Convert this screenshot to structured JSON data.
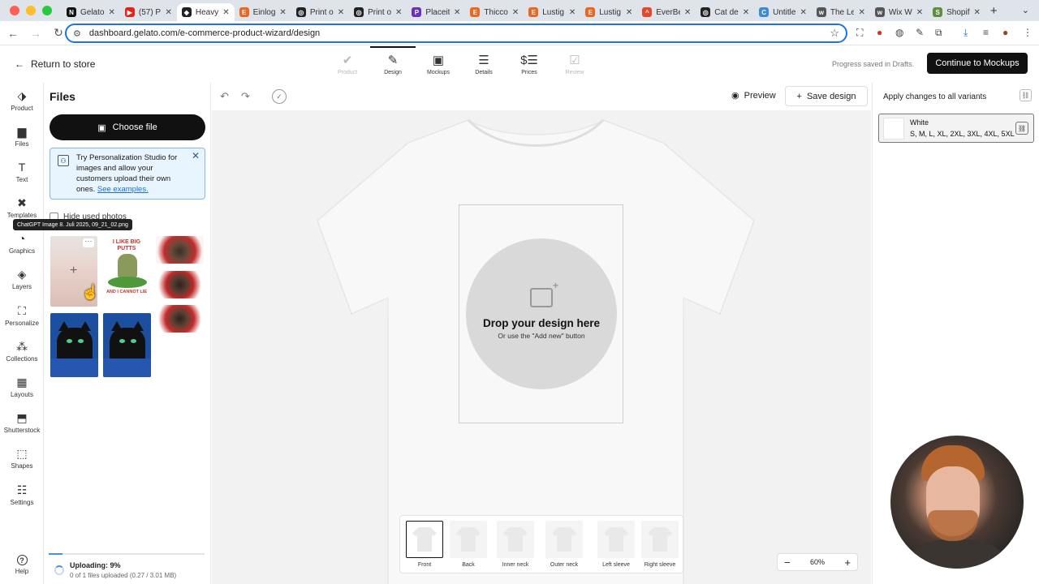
{
  "browser": {
    "tabs": [
      {
        "label": "Gelato",
        "icon": "notion-icon",
        "fav_color": "#111111",
        "fav_text": "N"
      },
      {
        "label": "(57) P",
        "icon": "youtube-icon",
        "fav_color": "#e62117",
        "fav_text": "▶"
      },
      {
        "label": "Heavy",
        "icon": "gelato-icon",
        "fav_color": "#222222",
        "fav_text": "◆",
        "active": true
      },
      {
        "label": "Einlog",
        "icon": "etsy-icon",
        "fav_color": "#f1641e",
        "fav_text": "E"
      },
      {
        "label": "Print o",
        "icon": "chatgpt-icon",
        "fav_color": "#222222",
        "fav_text": "◎"
      },
      {
        "label": "Print o",
        "icon": "chatgpt-icon",
        "fav_color": "#222222",
        "fav_text": "◎"
      },
      {
        "label": "Placeit",
        "icon": "placeit-icon",
        "fav_color": "#6b2fbf",
        "fav_text": "P"
      },
      {
        "label": "Thicco",
        "icon": "etsy-icon",
        "fav_color": "#f1641e",
        "fav_text": "E"
      },
      {
        "label": "Lustig",
        "icon": "etsy-icon",
        "fav_color": "#f1641e",
        "fav_text": "E"
      },
      {
        "label": "Lustig",
        "icon": "etsy-icon",
        "fav_color": "#f1641e",
        "fav_text": "E"
      },
      {
        "label": "EverBe",
        "icon": "everbee-icon",
        "fav_color": "#e8462a",
        "fav_text": "^"
      },
      {
        "label": "Cat de",
        "icon": "chatgpt-icon",
        "fav_color": "#222222",
        "fav_text": "◎"
      },
      {
        "label": "Untitle",
        "icon": "canva-icon",
        "fav_color": "#3b8bd9",
        "fav_text": "C"
      },
      {
        "label": "The Le",
        "icon": "wix-icon",
        "fav_color": "#555555",
        "fav_text": "w"
      },
      {
        "label": "Wix W",
        "icon": "wix-icon",
        "fav_color": "#555555",
        "fav_text": "w"
      },
      {
        "label": "Shopif",
        "icon": "shopify-icon",
        "fav_color": "#5e8e3e",
        "fav_text": "S"
      }
    ],
    "url": "dashboard.gelato.com/e-commerce-product-wizard/design"
  },
  "header": {
    "back_label": "Return to store",
    "steps": [
      {
        "label": "Product",
        "icon": "check-circle-icon",
        "glyph": "✔",
        "state": "done"
      },
      {
        "label": "Design",
        "icon": "pencil-icon",
        "glyph": "✎",
        "state": "active"
      },
      {
        "label": "Mockups",
        "icon": "image-icon",
        "glyph": "▣",
        "state": "normal"
      },
      {
        "label": "Details",
        "icon": "list-icon",
        "glyph": "☰",
        "state": "normal"
      },
      {
        "label": "Prices",
        "icon": "dollar-icon",
        "glyph": "$☰",
        "state": "normal"
      },
      {
        "label": "Review",
        "icon": "checklist-icon",
        "glyph": "☑",
        "state": "disabled"
      }
    ],
    "progress_text": "Progress saved in Drafts.",
    "continue_label": "Continue to Mockups"
  },
  "rail": [
    {
      "label": "Product",
      "icon": "tag-icon",
      "glyph": "⬗"
    },
    {
      "label": "Files",
      "icon": "files-icon",
      "glyph": "▆"
    },
    {
      "label": "Text",
      "icon": "text-icon",
      "glyph": "T"
    },
    {
      "label": "Templates",
      "icon": "templates-icon",
      "glyph": "✖"
    },
    {
      "label": "Graphics",
      "icon": "graphics-icon",
      "glyph": "◔"
    },
    {
      "label": "Layers",
      "icon": "layers-icon",
      "glyph": "◈"
    },
    {
      "label": "Personalize",
      "icon": "personalize-icon",
      "glyph": "⛶"
    },
    {
      "label": "Collections",
      "icon": "collections-icon",
      "glyph": "⁂"
    },
    {
      "label": "Layouts",
      "icon": "layouts-icon",
      "glyph": "▦"
    },
    {
      "label": "Shutterstock",
      "icon": "shutterstock-icon",
      "glyph": "⬒"
    },
    {
      "label": "Shapes",
      "icon": "shapes-icon",
      "glyph": "⬚"
    },
    {
      "label": "Settings",
      "icon": "settings-sliders-icon",
      "glyph": "☷"
    }
  ],
  "help_label": "Help",
  "files": {
    "title": "Files",
    "choose_label": "Choose file",
    "promo_text": "Try Personalization Studio for images and allow your customers upload their own ones.",
    "promo_link": "See examples.",
    "hide_used_label": "Hide used photos",
    "tooltip": "ChatGPT Image 8. Juli 2025, 09_21_02.png",
    "golf_text_top": "I LIKE BIG PUTTS",
    "golf_text_bottom": "AND I CANNOT LIE",
    "upload_status": "Uploading: 9%",
    "upload_progress": 0.09,
    "upload_detail": "0 of 1 files uploaded (0.27 / 3.01 MB)"
  },
  "canvas": {
    "preview_label": "Preview",
    "save_label": "Save design",
    "drop_title": "Drop your design here",
    "drop_sub": "Or use the \"Add new\" button",
    "views": [
      {
        "label": "Front",
        "selected": true
      },
      {
        "label": "Back"
      },
      {
        "label": "Inner neck"
      },
      {
        "label": "Outer neck"
      },
      {
        "label": "Left sleeve"
      },
      {
        "label": "Right sleeve"
      }
    ],
    "zoom": "60%"
  },
  "variants": {
    "apply_label": "Apply changes to all variants",
    "name": "White",
    "sizes": "S, M, L, XL, 2XL, 3XL, 4XL, 5XL"
  }
}
